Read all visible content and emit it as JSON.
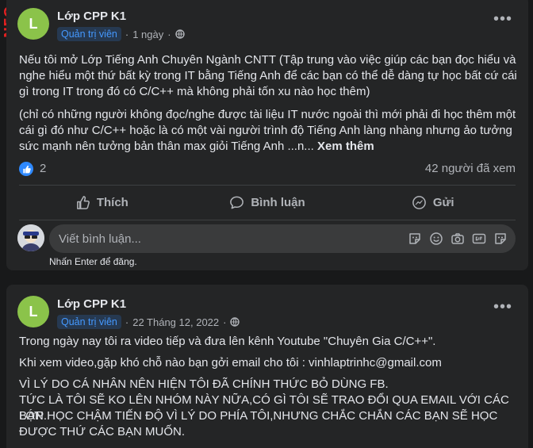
{
  "side_stamp": "NFO",
  "posts": [
    {
      "avatar_letter": "L",
      "group_name": "Lớp CPP K1",
      "role_badge": "Quản trị viên",
      "time": "1 ngày",
      "paragraphs": [
        "Nếu tôi mở Lớp Tiếng Anh Chuyên Ngành CNTT (Tập trung vào việc giúp các bạn đọc hiểu và nghe hiểu một thứ bất kỳ trong IT bằng Tiếng Anh để các bạn có thể dễ dàng tự học bất cứ cái gì trong IT trong đó có C/C++ mà không phải tốn xu nào học thêm)",
        "(chỉ có những người không đọc/nghe được tài liệu IT nước ngoài thì mới phải đi học thêm một cái gì đó như C/C++ hoặc là có một vài người trình độ Tiếng Anh làng nhàng nhưng ảo tưởng sức mạnh nên tưởng bản thân max giỏi Tiếng Anh ...n..."
      ],
      "see_more": "Xem thêm",
      "like_count": "2",
      "seen_count": "42 người đã xem",
      "actions": {
        "like": "Thích",
        "comment": "Bình luận",
        "send": "Gửi"
      },
      "comment_placeholder": "Viết bình luận...",
      "enter_hint": "Nhấn Enter để đăng."
    },
    {
      "avatar_letter": "L",
      "group_name": "Lớp CPP K1",
      "role_badge": "Quản trị viên",
      "time": "22 Tháng 12, 2022",
      "paragraphs": [
        "Trong ngày nay tôi ra video tiếp và đưa lên kênh Youtube \"Chuyên Gia C/C++\".",
        "Khi xem video,gặp khó chỗ nào bạn gởi email cho tôi : vinhlaptrinhc@gmail.com",
        "VÌ LÝ DO CÁ NHÂN NÊN HIỆN TÔI ĐÃ CHÍNH THỨC BỎ DÙNG FB.",
        "TỨC LÀ TÔI SẼ KO LÊN NHÓM NÀY NỮA,CÓ GÌ TÔI SẼ TRAO ĐỔI QUA EMAIL VỚI CÁC BẠN.",
        "LỚP HỌC CHẬM TIẾN ĐỘ VÌ LÝ DO PHÍA TÔI,NHƯNG CHẮC CHẮN CÁC BẠN SẼ HỌC ĐƯỢC THỨ CÁC BẠN MUỐN."
      ]
    }
  ],
  "icons": [
    "more-options-icon",
    "globe-icon",
    "like-icon",
    "comment-icon",
    "messenger-icon",
    "sticker-icon",
    "emoji-icon",
    "camera-icon",
    "gif-icon",
    "avatar-sticker-icon"
  ],
  "colors": {
    "background": "#18191a",
    "card": "#242526",
    "accent": "#2e89ff",
    "badge_text": "#4599ff"
  }
}
